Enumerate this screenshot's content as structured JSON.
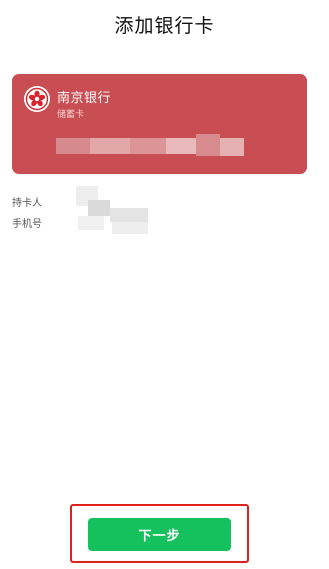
{
  "header": {
    "title": "添加银行卡"
  },
  "card": {
    "bank_name": "南京银行",
    "card_type": "储蓄卡",
    "logo_icon": "nanjing-bank-logo-icon",
    "background_color": "#c94e53"
  },
  "form": {
    "holder_label": "持卡人",
    "phone_label": "手机号"
  },
  "footer": {
    "next_label": "下一步",
    "button_color": "#15c15c",
    "highlight_color": "#e0221d"
  }
}
